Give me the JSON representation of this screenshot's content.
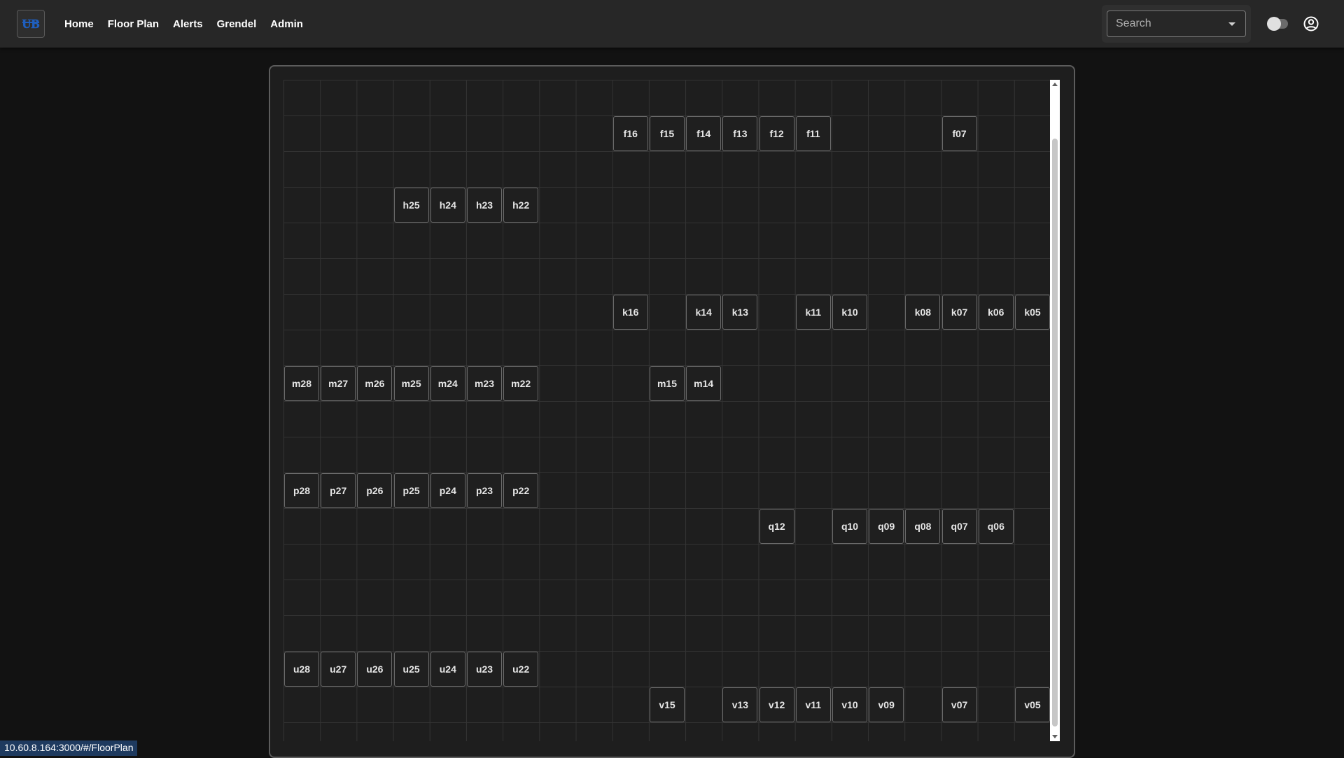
{
  "navbar": {
    "logo_icon": "university-logo-icon",
    "links": [
      "Home",
      "Floor Plan",
      "Alerts",
      "Grendel",
      "Admin"
    ],
    "search": {
      "placeholder": "Search"
    },
    "theme_toggle_icon": "theme-toggle-icon",
    "account_icon": "account-circle-icon"
  },
  "floorplan": {
    "seats": [
      {
        "label": "f16",
        "col": 9,
        "row": 1
      },
      {
        "label": "f15",
        "col": 10,
        "row": 1
      },
      {
        "label": "f14",
        "col": 11,
        "row": 1
      },
      {
        "label": "f13",
        "col": 12,
        "row": 1
      },
      {
        "label": "f12",
        "col": 13,
        "row": 1
      },
      {
        "label": "f11",
        "col": 14,
        "row": 1
      },
      {
        "label": "f07",
        "col": 18,
        "row": 1
      },
      {
        "label": "h25",
        "col": 3,
        "row": 3
      },
      {
        "label": "h24",
        "col": 4,
        "row": 3
      },
      {
        "label": "h23",
        "col": 5,
        "row": 3
      },
      {
        "label": "h22",
        "col": 6,
        "row": 3
      },
      {
        "label": "k16",
        "col": 9,
        "row": 6
      },
      {
        "label": "k14",
        "col": 11,
        "row": 6
      },
      {
        "label": "k13",
        "col": 12,
        "row": 6
      },
      {
        "label": "k11",
        "col": 14,
        "row": 6
      },
      {
        "label": "k10",
        "col": 15,
        "row": 6
      },
      {
        "label": "k08",
        "col": 17,
        "row": 6
      },
      {
        "label": "k07",
        "col": 18,
        "row": 6
      },
      {
        "label": "k06",
        "col": 19,
        "row": 6
      },
      {
        "label": "k05",
        "col": 20,
        "row": 6
      },
      {
        "label": "m28",
        "col": 0,
        "row": 8
      },
      {
        "label": "m27",
        "col": 1,
        "row": 8
      },
      {
        "label": "m26",
        "col": 2,
        "row": 8
      },
      {
        "label": "m25",
        "col": 3,
        "row": 8
      },
      {
        "label": "m24",
        "col": 4,
        "row": 8
      },
      {
        "label": "m23",
        "col": 5,
        "row": 8
      },
      {
        "label": "m22",
        "col": 6,
        "row": 8
      },
      {
        "label": "m15",
        "col": 10,
        "row": 8
      },
      {
        "label": "m14",
        "col": 11,
        "row": 8
      },
      {
        "label": "p28",
        "col": 0,
        "row": 11
      },
      {
        "label": "p27",
        "col": 1,
        "row": 11
      },
      {
        "label": "p26",
        "col": 2,
        "row": 11
      },
      {
        "label": "p25",
        "col": 3,
        "row": 11
      },
      {
        "label": "p24",
        "col": 4,
        "row": 11
      },
      {
        "label": "p23",
        "col": 5,
        "row": 11
      },
      {
        "label": "p22",
        "col": 6,
        "row": 11
      },
      {
        "label": "q12",
        "col": 13,
        "row": 12
      },
      {
        "label": "q10",
        "col": 15,
        "row": 12
      },
      {
        "label": "q09",
        "col": 16,
        "row": 12
      },
      {
        "label": "q08",
        "col": 17,
        "row": 12
      },
      {
        "label": "q07",
        "col": 18,
        "row": 12
      },
      {
        "label": "q06",
        "col": 19,
        "row": 12
      },
      {
        "label": "u28",
        "col": 0,
        "row": 16
      },
      {
        "label": "u27",
        "col": 1,
        "row": 16
      },
      {
        "label": "u26",
        "col": 2,
        "row": 16
      },
      {
        "label": "u25",
        "col": 3,
        "row": 16
      },
      {
        "label": "u24",
        "col": 4,
        "row": 16
      },
      {
        "label": "u23",
        "col": 5,
        "row": 16
      },
      {
        "label": "u22",
        "col": 6,
        "row": 16
      },
      {
        "label": "v15",
        "col": 10,
        "row": 17
      },
      {
        "label": "v13",
        "col": 12,
        "row": 17
      },
      {
        "label": "v12",
        "col": 13,
        "row": 17
      },
      {
        "label": "v11",
        "col": 14,
        "row": 17
      },
      {
        "label": "v10",
        "col": 15,
        "row": 17
      },
      {
        "label": "v09",
        "col": 16,
        "row": 17
      },
      {
        "label": "v07",
        "col": 18,
        "row": 17
      },
      {
        "label": "v05",
        "col": 20,
        "row": 17
      }
    ]
  },
  "status_bar": {
    "url": "10.60.8.164:3000/#/FloorPlan"
  },
  "colors": {
    "navbar_bg": "#272727",
    "page_bg": "#121212",
    "panel_bg": "#1e1e1e",
    "logo_blue": "#1f5fbf"
  }
}
